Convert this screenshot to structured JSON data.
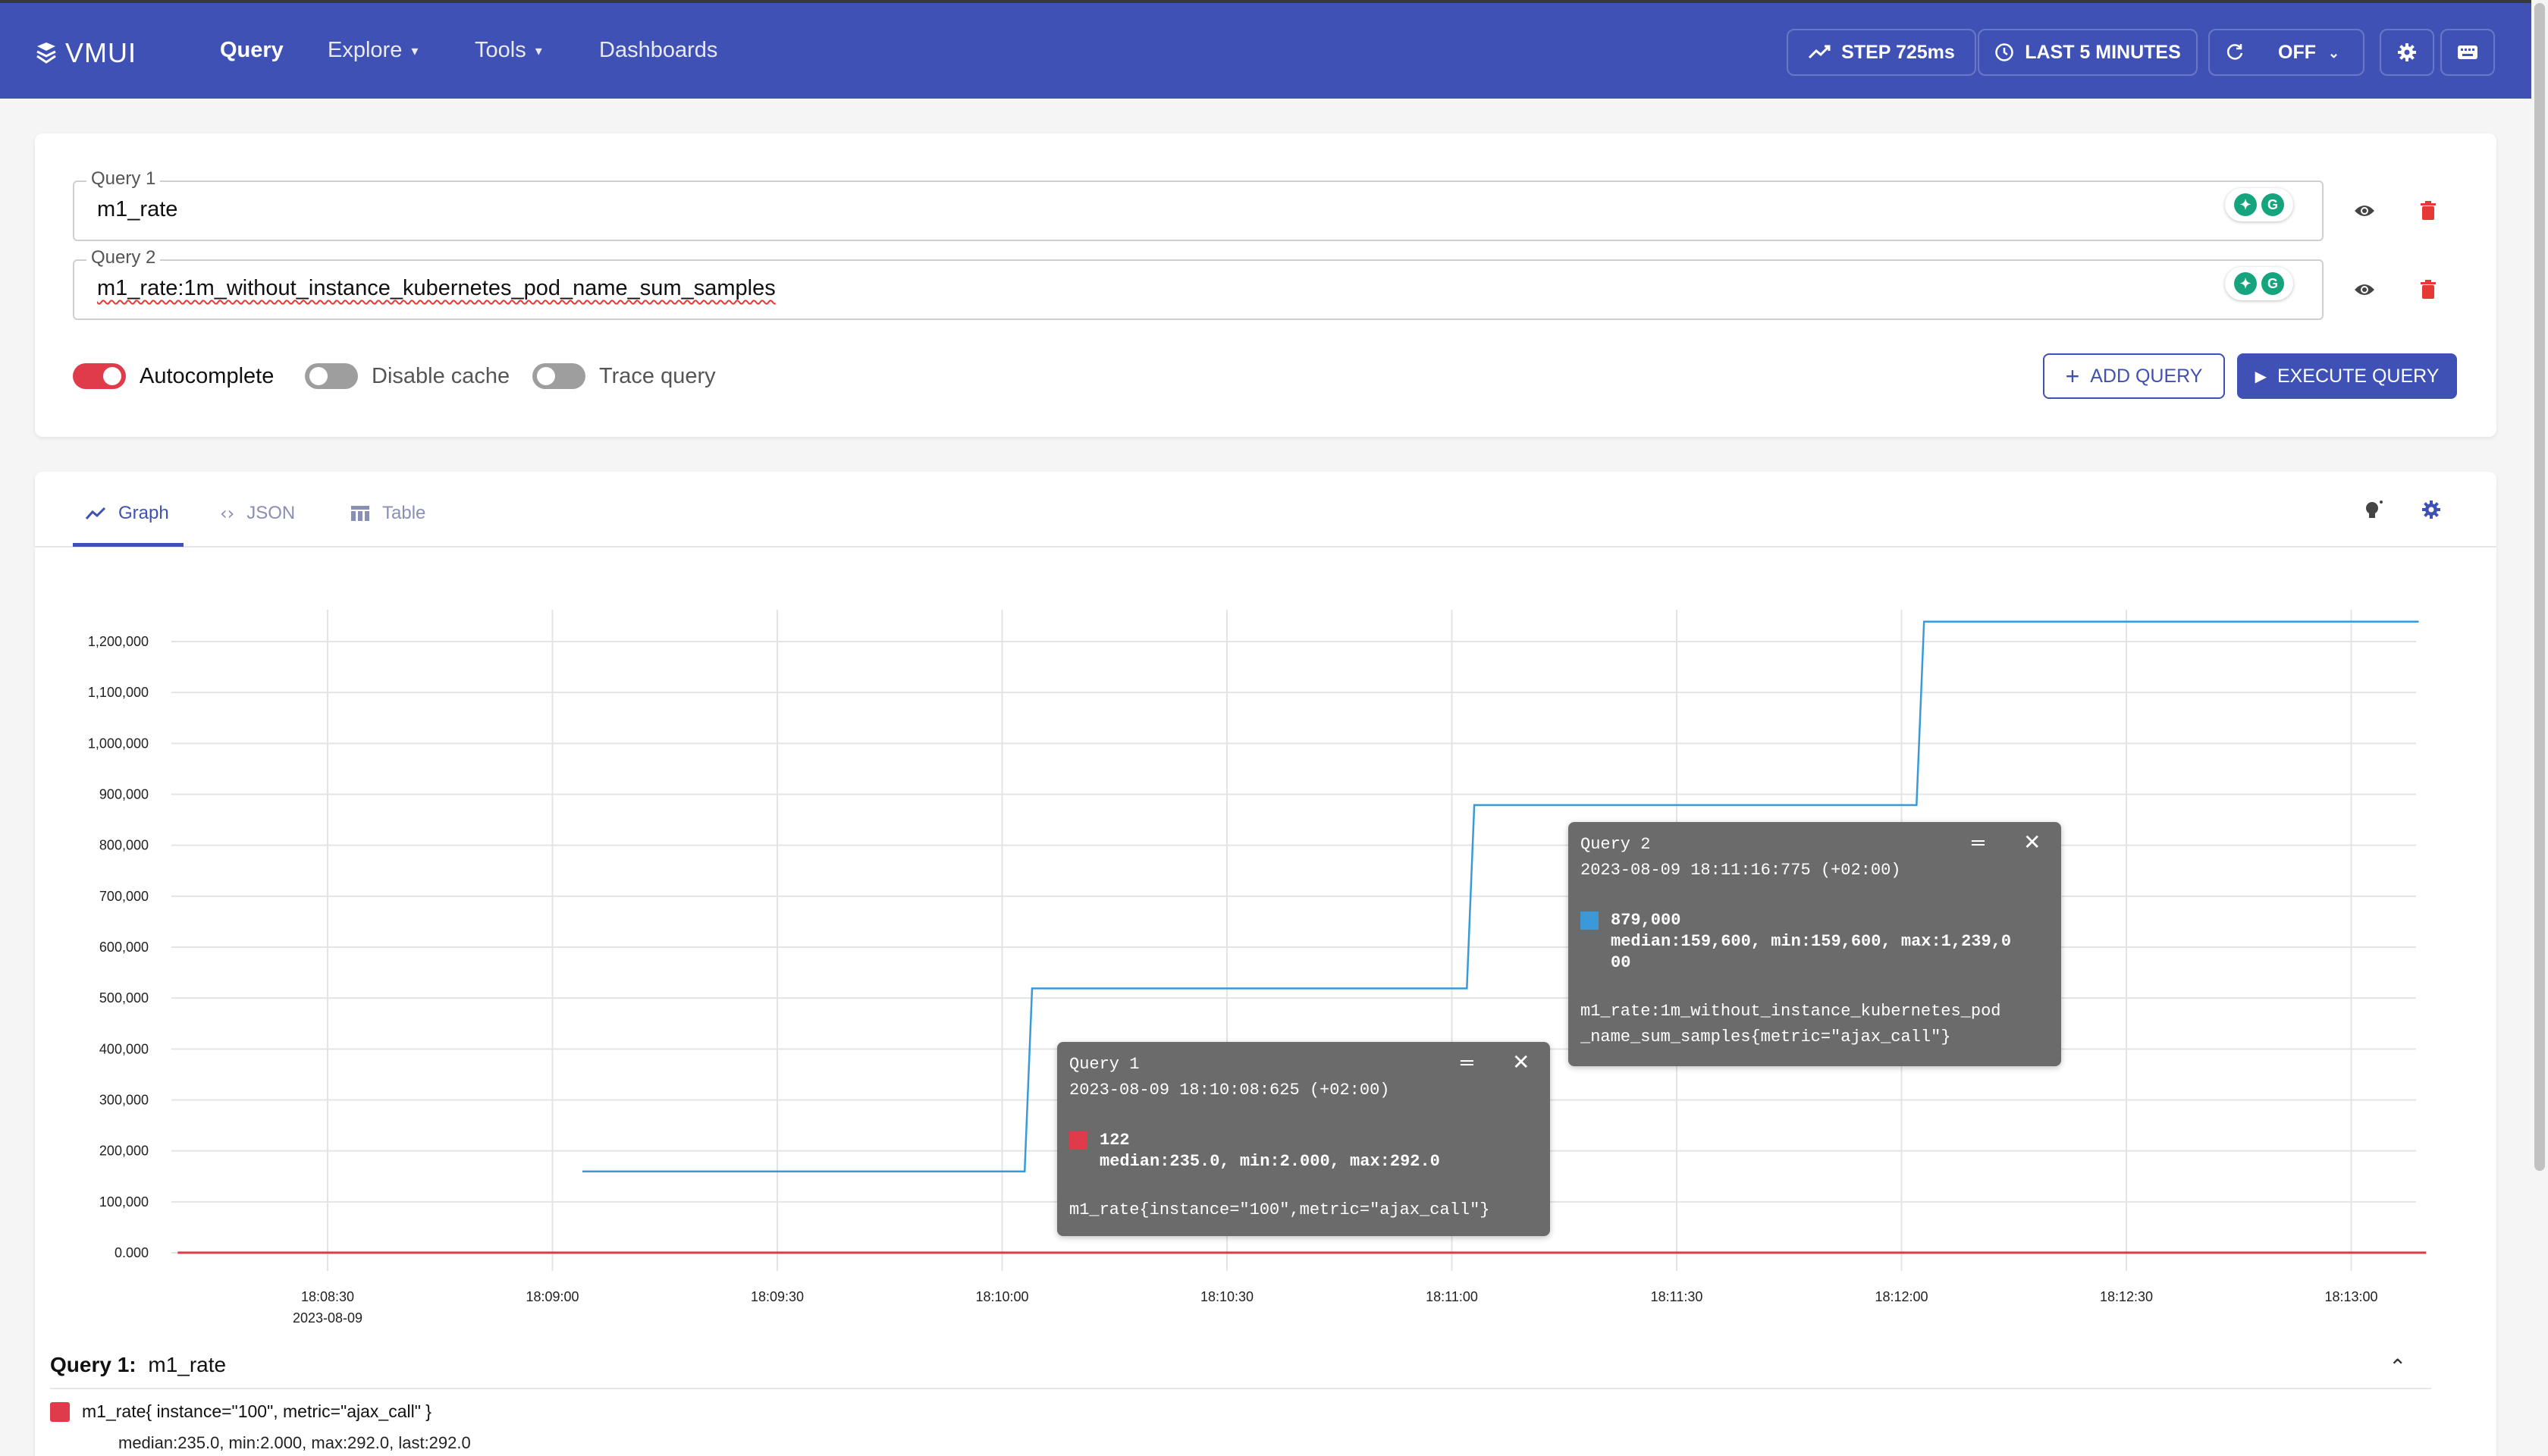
{
  "app": {
    "logo": "VMUI"
  },
  "nav": {
    "query": "Query",
    "explore": "Explore",
    "tools": "Tools",
    "dashboards": "Dashboards"
  },
  "header": {
    "step": "STEP 725ms",
    "time_range": "LAST 5 MINUTES",
    "refresh": "OFF"
  },
  "queries": [
    {
      "label": "Query 1",
      "value": "m1_rate"
    },
    {
      "label": "Query 2",
      "value": "m1_rate:1m_without_instance_kubernetes_pod_name_sum_samples"
    }
  ],
  "options": {
    "autocomplete": "Autocomplete",
    "disable_cache": "Disable cache",
    "trace_query": "Trace query",
    "autocomplete_on": true,
    "disable_cache_on": false,
    "trace_query_on": false
  },
  "actions": {
    "add_query": "ADD QUERY",
    "execute_query": "EXECUTE QUERY"
  },
  "tabs": {
    "graph": "Graph",
    "json": "JSON",
    "table": "Table"
  },
  "colors": {
    "accent": "#3f51b5",
    "series1": "#e03b4a",
    "series2": "#3a9ad9",
    "toggle_on": "#e03b4a"
  },
  "chart_data": {
    "type": "line",
    "y_ticks": [
      "0.000",
      "100,000",
      "200,000",
      "300,000",
      "400,000",
      "500,000",
      "600,000",
      "700,000",
      "800,000",
      "900,000",
      "1,000,000",
      "1,100,000",
      "1,200,000"
    ],
    "ylim": [
      0,
      1200000
    ],
    "x_ticks": [
      "18:08:30",
      "18:09:00",
      "18:09:30",
      "18:10:00",
      "18:10:30",
      "18:11:00",
      "18:11:30",
      "18:12:00",
      "18:12:30",
      "18:13:00"
    ],
    "x_sub_label": "2023-08-09",
    "grid": true,
    "series": [
      {
        "name": "m1_rate{instance=\"100\",metric=\"ajax_call\"}",
        "color": "#e03b4a",
        "points": [
          [
            "18:08:10",
            122
          ],
          [
            "18:13:10",
            122
          ]
        ]
      },
      {
        "name": "m1_rate:1m_without_instance_kubernetes_pod_name_sum_samples{metric=\"ajax_call\"}",
        "color": "#3a9ad9",
        "points": [
          [
            "18:09:04",
            159600
          ],
          [
            "18:10:03",
            159600
          ],
          [
            "18:10:04",
            519000
          ],
          [
            "18:11:02",
            519000
          ],
          [
            "18:11:03",
            879000
          ],
          [
            "18:12:02",
            879000
          ],
          [
            "18:12:03",
            1239000
          ],
          [
            "18:13:09",
            1239000
          ]
        ]
      }
    ]
  },
  "tooltips": [
    {
      "title": "Query 1",
      "date": "2023-08-09 18:10:08:625 (+02:00)",
      "value": "122",
      "stats": "median:235.0, min:2.000, max:292.0",
      "name": "m1_rate{instance=\"100\",metric=\"ajax_call\"}",
      "color": "#e03b4a"
    },
    {
      "title": "Query 2",
      "date": "2023-08-09 18:11:16:775 (+02:00)",
      "value": "879,000",
      "stats1": "median:159,600, min:159,600, max:1,239,0",
      "stats2": "00",
      "name1": "m1_rate:1m_without_instance_kubernetes_pod",
      "name2": "_name_sum_samples{metric=\"ajax_call\"}",
      "color": "#3a9ad9"
    }
  ],
  "legend": {
    "title": "Query 1:",
    "query": "m1_rate",
    "item": "m1_rate{ instance=\"100\", metric=\"ajax_call\" }",
    "stats": "median:235.0, min:2.000, max:292.0, last:292.0"
  }
}
